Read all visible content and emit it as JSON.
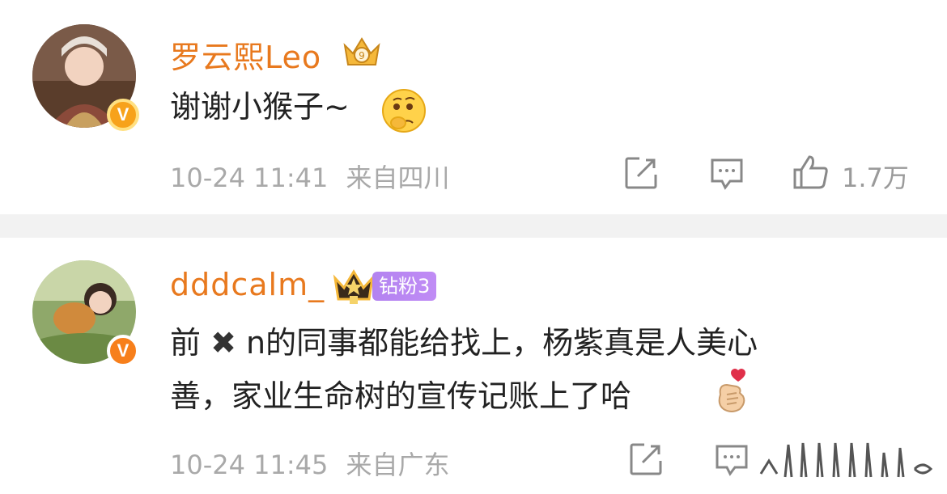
{
  "comments": [
    {
      "username": "罗云熙Leo",
      "text_before_emoji": "谢谢小猴子~",
      "time": "10-24 11:41",
      "location": "来自四川",
      "likes": "1.7万",
      "avatar_icon": "avatar-photo",
      "badge_icon": "crown-icon",
      "emoji_icon": "thinking-face-emoji"
    },
    {
      "username": "dddcalm_",
      "fan_badge": "钻粉3",
      "line1_a": "前",
      "line1_x": "✖",
      "line1_b": "n的同事都能给找上，杨紫真是人美心",
      "line2": "善，家业生命树的宣传记账上了哈",
      "time": "10-24 11:45",
      "location": "来自广东",
      "avatar_icon": "avatar-photo",
      "badge_icon": "crown-icon",
      "emoji_icon": "finger-heart-emoji"
    }
  ],
  "colors": {
    "username": "#e8791e",
    "meta": "#a9a9a9",
    "divider": "#f2f2f2",
    "fan_badge": "#b383f0"
  }
}
